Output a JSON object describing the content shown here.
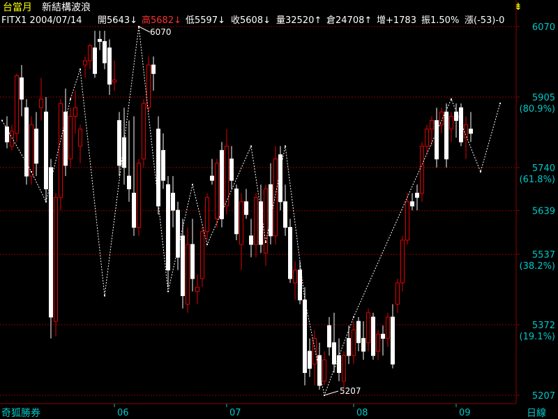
{
  "header": {
    "title": "台當月",
    "subtitle": "新結構波浪",
    "symbol_date": "FITX1 2004/07/14",
    "open": "開5643↓",
    "high": "高5682↓",
    "low": "低5597↓",
    "close": "收5608↓",
    "volume": "量32520↑",
    "open_interest": "倉24708↑",
    "oi_change": "增+1783",
    "amplitude": "振1.50%",
    "change": "漲(-53)-0",
    "marker_icon": "down-arrow-icon"
  },
  "footer": {
    "brand": "奇狐勝券",
    "period": "日線"
  },
  "colors": {
    "up": "#e60000",
    "down": "#ffffff",
    "grid": "#8b0000",
    "axis_text": "#00c8c8",
    "title": "#ffff00",
    "zigzag": "#ffffff"
  },
  "chart_data": {
    "type": "candlestick",
    "ylim": [
      5207,
      6070
    ],
    "y_ticks": [
      {
        "value": 6070,
        "label": "6070",
        "sub": ""
      },
      {
        "value": 5905,
        "label": "5905",
        "sub": "(80.9%)"
      },
      {
        "value": 5740,
        "label": "5740",
        "sub": "(61.8%)"
      },
      {
        "value": 5639,
        "label": "5639",
        "sub": ""
      },
      {
        "value": 5537,
        "label": "5537",
        "sub": "(38.2%)"
      },
      {
        "value": 5372,
        "label": "5372",
        "sub": "(19.1%)"
      },
      {
        "value": 5207,
        "label": "5207",
        "sub": ""
      }
    ],
    "x_ticks": [
      {
        "label": "06",
        "index": 22
      },
      {
        "label": "07",
        "index": 45
      },
      {
        "label": "08",
        "index": 71
      },
      {
        "label": "09",
        "index": 92
      }
    ],
    "peak_label": "6070",
    "trough_label": "5207",
    "candles": [
      [
        5835,
        5860,
        5785,
        5800
      ],
      [
        5790,
        5840,
        5780,
        5825
      ],
      [
        5820,
        5960,
        5800,
        5955
      ],
      [
        5950,
        5980,
        5860,
        5900
      ],
      [
        5880,
        5900,
        5700,
        5720
      ],
      [
        5720,
        5860,
        5700,
        5840
      ],
      [
        5830,
        5870,
        5720,
        5750
      ],
      [
        5880,
        5950,
        5850,
        5900
      ],
      [
        5870,
        5905,
        5660,
        5690
      ],
      [
        5740,
        5760,
        5340,
        5390
      ],
      [
        5380,
        5680,
        5345,
        5670
      ],
      [
        5670,
        5900,
        5640,
        5890
      ],
      [
        5870,
        5925,
        5720,
        5745
      ],
      [
        5760,
        5880,
        5740,
        5860
      ],
      [
        5860,
        5920,
        5820,
        5880
      ],
      [
        5790,
        5840,
        5750,
        5830
      ],
      [
        5980,
        6000,
        5950,
        5990
      ],
      [
        5990,
        6030,
        5970,
        6025
      ],
      [
        6020,
        6060,
        5950,
        5960
      ],
      [
        6040,
        6060,
        6015,
        6035
      ],
      [
        6035,
        6060,
        5970,
        5985
      ],
      [
        6020,
        6040,
        5910,
        5935
      ],
      [
        5940,
        5990,
        5920,
        5945
      ],
      [
        5850,
        5870,
        5720,
        5745
      ],
      [
        5810,
        5880,
        5700,
        5740
      ],
      [
        5720,
        5850,
        5660,
        5690
      ],
      [
        5680,
        5860,
        5580,
        5600
      ],
      [
        5600,
        5760,
        5580,
        5750
      ],
      [
        5760,
        5900,
        5740,
        5890
      ],
      [
        5880,
        6000,
        5870,
        5980
      ],
      [
        5980,
        6000,
        5920,
        5960
      ],
      [
        5830,
        5860,
        5630,
        5650
      ],
      [
        5780,
        5820,
        5690,
        5710
      ],
      [
        5700,
        5720,
        5460,
        5500
      ],
      [
        5680,
        5720,
        5600,
        5640
      ],
      [
        5640,
        5660,
        5500,
        5530
      ],
      [
        5580,
        5620,
        5410,
        5440
      ],
      [
        5420,
        5600,
        5400,
        5560
      ],
      [
        5560,
        5620,
        5450,
        5480
      ],
      [
        5450,
        5490,
        5420,
        5460
      ],
      [
        5480,
        5600,
        5460,
        5590
      ],
      [
        5590,
        5680,
        5570,
        5670
      ],
      [
        5720,
        5760,
        5700,
        5710
      ],
      [
        5620,
        5760,
        5600,
        5750
      ],
      [
        5780,
        5800,
        5600,
        5620
      ],
      [
        5650,
        5830,
        5630,
        5790
      ],
      [
        5760,
        5790,
        5690,
        5710
      ],
      [
        5690,
        5700,
        5570,
        5585
      ],
      [
        5560,
        5680,
        5500,
        5660
      ],
      [
        5660,
        5690,
        5620,
        5630
      ],
      [
        5580,
        5620,
        5530,
        5560
      ],
      [
        5560,
        5680,
        5530,
        5670
      ],
      [
        5660,
        5700,
        5540,
        5560
      ],
      [
        5540,
        5700,
        5510,
        5690
      ],
      [
        5700,
        5750,
        5560,
        5580
      ],
      [
        5580,
        5790,
        5560,
        5760
      ],
      [
        5770,
        5790,
        5640,
        5660
      ],
      [
        5660,
        5700,
        5580,
        5600
      ],
      [
        5600,
        5620,
        5470,
        5480
      ],
      [
        5470,
        5520,
        5430,
        5500
      ],
      [
        5500,
        5520,
        5420,
        5430
      ],
      [
        5430,
        5460,
        5230,
        5260
      ],
      [
        5310,
        5340,
        5250,
        5270
      ],
      [
        5280,
        5360,
        5230,
        5340
      ],
      [
        5300,
        5330,
        5220,
        5230
      ],
      [
        5240,
        5310,
        5230,
        5290
      ],
      [
        5370,
        5390,
        5300,
        5320
      ],
      [
        5330,
        5400,
        5260,
        5280
      ],
      [
        5300,
        5340,
        5240,
        5260
      ],
      [
        5240,
        5310,
        5220,
        5300
      ],
      [
        5340,
        5370,
        5280,
        5300
      ],
      [
        5300,
        5380,
        5280,
        5360
      ],
      [
        5380,
        5390,
        5310,
        5330
      ],
      [
        5340,
        5380,
        5290,
        5310
      ],
      [
        5330,
        5410,
        5310,
        5400
      ],
      [
        5390,
        5400,
        5290,
        5300
      ],
      [
        5310,
        5360,
        5290,
        5350
      ],
      [
        5350,
        5370,
        5300,
        5340
      ],
      [
        5340,
        5400,
        5320,
        5390
      ],
      [
        5390,
        5420,
        5270,
        5280
      ],
      [
        5420,
        5480,
        5400,
        5470
      ],
      [
        5470,
        5580,
        5450,
        5570
      ],
      [
        5570,
        5680,
        5560,
        5660
      ],
      [
        5660,
        5680,
        5640,
        5650
      ],
      [
        5680,
        5700,
        5640,
        5670
      ],
      [
        5680,
        5800,
        5660,
        5790
      ],
      [
        5790,
        5840,
        5770,
        5830
      ],
      [
        5830,
        5860,
        5790,
        5850
      ],
      [
        5850,
        5880,
        5740,
        5760
      ],
      [
        5840,
        5880,
        5820,
        5870
      ],
      [
        5870,
        5890,
        5740,
        5760
      ],
      [
        5830,
        5870,
        5800,
        5860
      ],
      [
        5870,
        5890,
        5810,
        5850
      ],
      [
        5880,
        5890,
        5790,
        5800
      ],
      [
        5810,
        5860,
        5760,
        5840
      ],
      [
        5830,
        5870,
        5800,
        5820
      ]
    ],
    "zigzag": [
      [
        -1,
        5850
      ],
      [
        5,
        5730
      ],
      [
        8,
        5660
      ],
      [
        13,
        5900
      ],
      [
        15,
        5970
      ],
      [
        20,
        5440
      ],
      [
        27,
        6070
      ],
      [
        33,
        5450
      ],
      [
        38,
        5700
      ],
      [
        41,
        5560
      ],
      [
        50,
        5790
      ],
      [
        53,
        5565
      ],
      [
        57,
        5790
      ],
      [
        61,
        5430
      ],
      [
        65,
        5207
      ],
      [
        71,
        5390
      ],
      [
        91,
        5900
      ],
      [
        97,
        5730
      ],
      [
        101,
        5890
      ]
    ]
  }
}
